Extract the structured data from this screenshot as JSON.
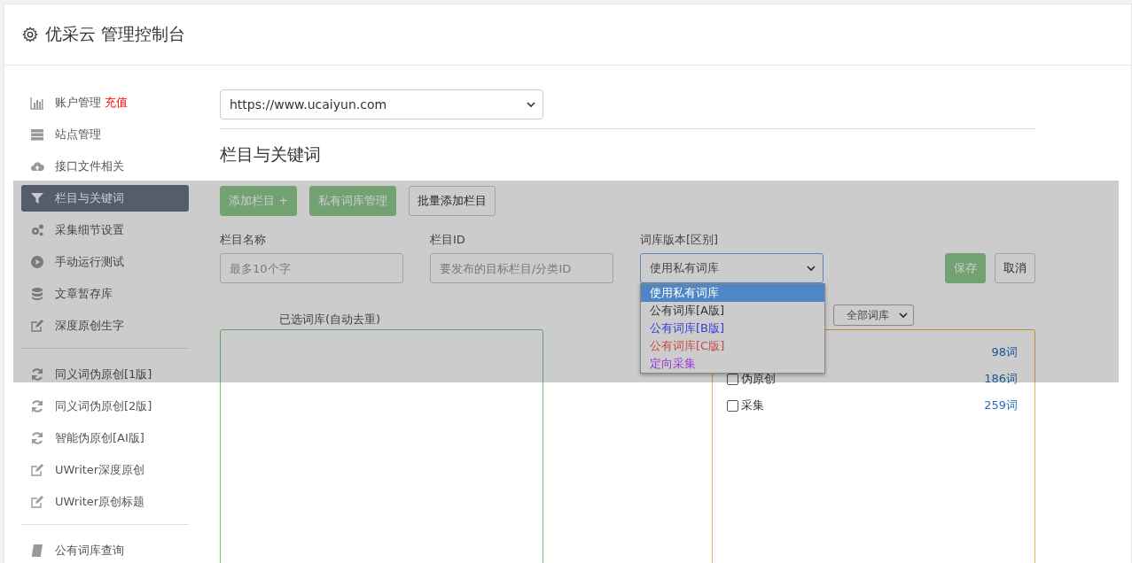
{
  "header": {
    "title": "优采云 管理控制台"
  },
  "sidebar": {
    "groups": [
      [
        {
          "label": "账户管理",
          "badge": "充值",
          "selected": false
        },
        {
          "label": "站点管理",
          "selected": false
        },
        {
          "label": "接口文件相关",
          "selected": false
        },
        {
          "label": "栏目与关键词",
          "selected": true
        },
        {
          "label": "采集细节设置",
          "selected": false
        },
        {
          "label": "手动运行测试",
          "selected": false
        },
        {
          "label": "文章暂存库",
          "selected": false
        },
        {
          "label": "深度原创生字",
          "selected": false
        }
      ],
      [
        {
          "label": "同义词伪原创[1版]",
          "selected": false
        },
        {
          "label": "同义词伪原创[2版]",
          "selected": false
        },
        {
          "label": "智能伪原创[AI版]",
          "selected": false
        },
        {
          "label": "UWriter深度原创",
          "selected": false
        },
        {
          "label": "UWriter原创标题",
          "selected": false
        }
      ],
      [
        {
          "label": "公有词库查询",
          "selected": false
        }
      ]
    ]
  },
  "site_select": {
    "value": "https://www.ucaiyun.com"
  },
  "section_title": "栏目与关键词",
  "toolbar": [
    {
      "label": "添加栏目 +",
      "kind": "primary"
    },
    {
      "label": "私有词库管理",
      "kind": "primary"
    },
    {
      "label": "批量添加栏目",
      "kind": "default"
    }
  ],
  "form": {
    "fields": [
      {
        "label": "栏目名称",
        "placeholder": "最多10个字",
        "kind": "input"
      },
      {
        "label": "栏目ID",
        "placeholder": "要发布的目标栏目/分类ID",
        "kind": "input"
      },
      {
        "label": "词库版本[区别]",
        "value": "使用私有词库",
        "kind": "select",
        "expanded": true
      }
    ],
    "options": [
      {
        "label": "使用私有词库",
        "selected": true
      },
      {
        "label": "公有词库[A版]",
        "selected": false,
        "color": "#333333"
      },
      {
        "label": "公有词库[B版]",
        "selected": false,
        "color": "#3a3ad8"
      },
      {
        "label": "公有词库[C版]",
        "selected": false,
        "color": "#c84a4a"
      },
      {
        "label": "定向采集",
        "selected": false,
        "color": "#9a34d6"
      }
    ],
    "buttons": [
      {
        "label": "保存",
        "kind": "primary"
      },
      {
        "label": "取消",
        "kind": "default"
      }
    ]
  },
  "selected_panel": {
    "title": "已选词库(自动去重)"
  },
  "library_panel": {
    "filter": "全部词库",
    "rows": [
      {
        "count": "98词"
      },
      {
        "label": "伪原创",
        "checked": false,
        "count": "186词"
      },
      {
        "label": "采集",
        "checked": false,
        "count": "259词"
      }
    ]
  }
}
